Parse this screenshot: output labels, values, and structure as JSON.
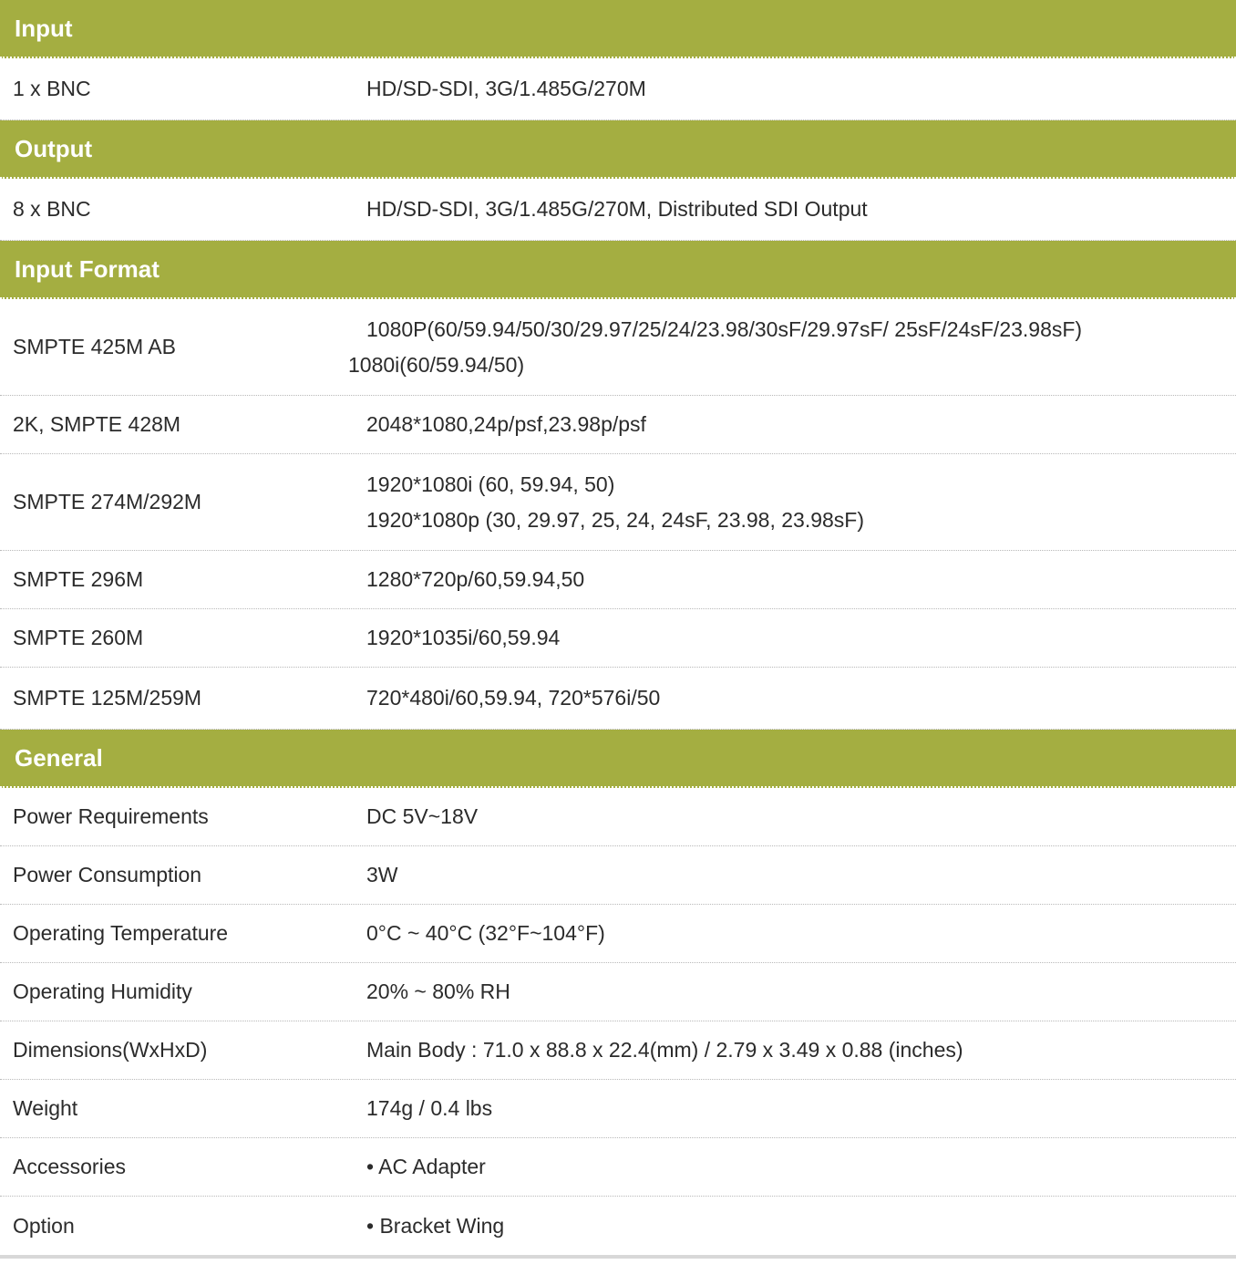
{
  "sections": {
    "input": {
      "title": "Input",
      "rows": [
        {
          "label": "1 x BNC",
          "value": "HD/SD-SDI, 3G/1.485G/270M"
        }
      ]
    },
    "output": {
      "title": "Output",
      "rows": [
        {
          "label": "8 x BNC",
          "value": "HD/SD-SDI, 3G/1.485G/270M, Distributed SDI Output"
        }
      ]
    },
    "input_format": {
      "title": "Input Format",
      "rows": [
        {
          "label": "SMPTE 425M AB",
          "lines": [
            "1080P(60/59.94/50/30/29.97/25/24/23.98/30sF/29.97sF/ 25sF/24sF/23.98sF)",
            "1080i(60/59.94/50)"
          ]
        },
        {
          "label": "2K, SMPTE 428M",
          "value": "2048*1080,24p/psf,23.98p/psf"
        },
        {
          "label": "SMPTE 274M/292M",
          "lines": [
            "1920*1080i (60, 59.94, 50)",
            "1920*1080p (30, 29.97, 25, 24, 24sF, 23.98, 23.98sF)"
          ]
        },
        {
          "label": "SMPTE 296M",
          "value": "1280*720p/60,59.94,50"
        },
        {
          "label": "SMPTE 260M",
          "value": "1920*1035i/60,59.94"
        },
        {
          "label": "SMPTE 125M/259M",
          "value": "720*480i/60,59.94, 720*576i/50"
        }
      ]
    },
    "general": {
      "title": "General",
      "rows": [
        {
          "label": "Power Requirements",
          "value": "DC 5V~18V"
        },
        {
          "label": "Power Consumption",
          "value": "3W"
        },
        {
          "label": "Operating Temperature",
          "value": "0°C ~ 40°C (32°F~104°F)"
        },
        {
          "label": "Operating Humidity",
          "value": "20% ~ 80% RH"
        },
        {
          "label": "Dimensions(WxHxD)",
          "value": "Main Body : 71.0 x 88.8 x 22.4(mm) / 2.79 x 3.49 x 0.88 (inches)"
        },
        {
          "label": "Weight",
          "value": "174g / 0.4 lbs"
        },
        {
          "label": "Accessories",
          "value": "• AC Adapter"
        },
        {
          "label": "Option",
          "value": "• Bracket Wing"
        }
      ]
    }
  },
  "colors": {
    "header_bg": "#a4ae41",
    "header_text": "#ffffff",
    "body_text": "#2b2b2b",
    "row_divider": "#b9b9b9"
  }
}
